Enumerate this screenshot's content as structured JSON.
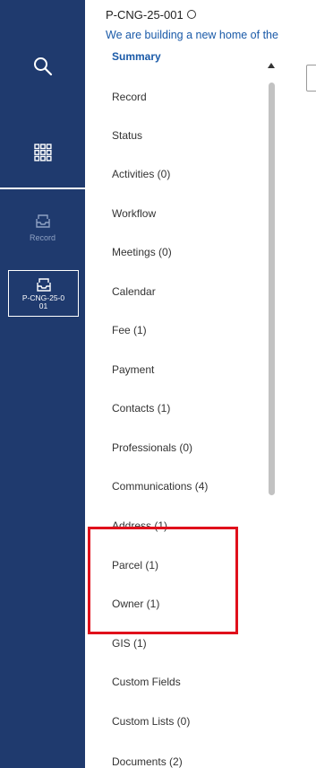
{
  "header": {
    "record_id": "P-CNG-25-001",
    "description": "We are building a new home of the"
  },
  "rail": {
    "record_label": "Record",
    "current_record_label": "P-CNG-25-001"
  },
  "nav": {
    "items": [
      {
        "label": "Summary"
      },
      {
        "label": "Record"
      },
      {
        "label": "Status"
      },
      {
        "label": "Activities (0)"
      },
      {
        "label": "Workflow"
      },
      {
        "label": "Meetings (0)"
      },
      {
        "label": "Calendar"
      },
      {
        "label": "Fee (1)"
      },
      {
        "label": "Payment"
      },
      {
        "label": "Contacts (1)"
      },
      {
        "label": "Professionals (0)"
      },
      {
        "label": "Communications (4)"
      },
      {
        "label": "Address (1)"
      },
      {
        "label": "Parcel (1)"
      },
      {
        "label": "Owner (1)"
      },
      {
        "label": "GIS (1)"
      },
      {
        "label": "Custom Fields"
      },
      {
        "label": "Custom Lists (0)"
      },
      {
        "label": "Documents (2)"
      }
    ]
  },
  "colors": {
    "rail": "#1f3a6e",
    "accent": "#1a5aa8",
    "highlight": "#e0101b"
  }
}
